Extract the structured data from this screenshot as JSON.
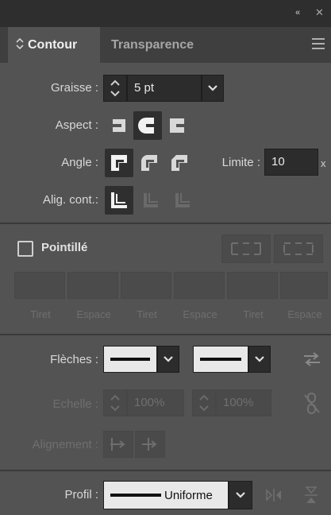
{
  "window": {
    "collapse_glyph": "«",
    "close_glyph": "✕"
  },
  "tabs": [
    {
      "label": "Contour",
      "icon": "updown-arrows-icon",
      "active": true
    },
    {
      "label": "Transparence",
      "active": false
    }
  ],
  "weight": {
    "label": "Graisse :",
    "value": "5 pt"
  },
  "cap": {
    "label": "Aspect :",
    "selected": "round-cap"
  },
  "corner": {
    "label": "Angle :",
    "selected": "miter-join",
    "limit_label": "Limite :",
    "limit_value": "10",
    "limit_suffix": "x"
  },
  "align": {
    "label": "Alig. cont.:",
    "selected": "center"
  },
  "dashed": {
    "label": "Pointillé",
    "checked": false,
    "fields": [
      "Tiret",
      "Espace",
      "Tiret",
      "Espace",
      "Tiret",
      "Espace"
    ]
  },
  "arrowheads": {
    "label": "Flèches :"
  },
  "scale": {
    "label": "Echelle :",
    "start": "100%",
    "end": "100%"
  },
  "alignment": {
    "label": "Alignement :"
  },
  "profile": {
    "label": "Profil :",
    "value": "Uniforme"
  },
  "colors": {
    "panel_bg": "#535353",
    "tab_bg": "#3f3f3f",
    "field_bg": "#2c2c2c",
    "text": "#d8d8d8",
    "disabled": "#6f6f6f"
  }
}
